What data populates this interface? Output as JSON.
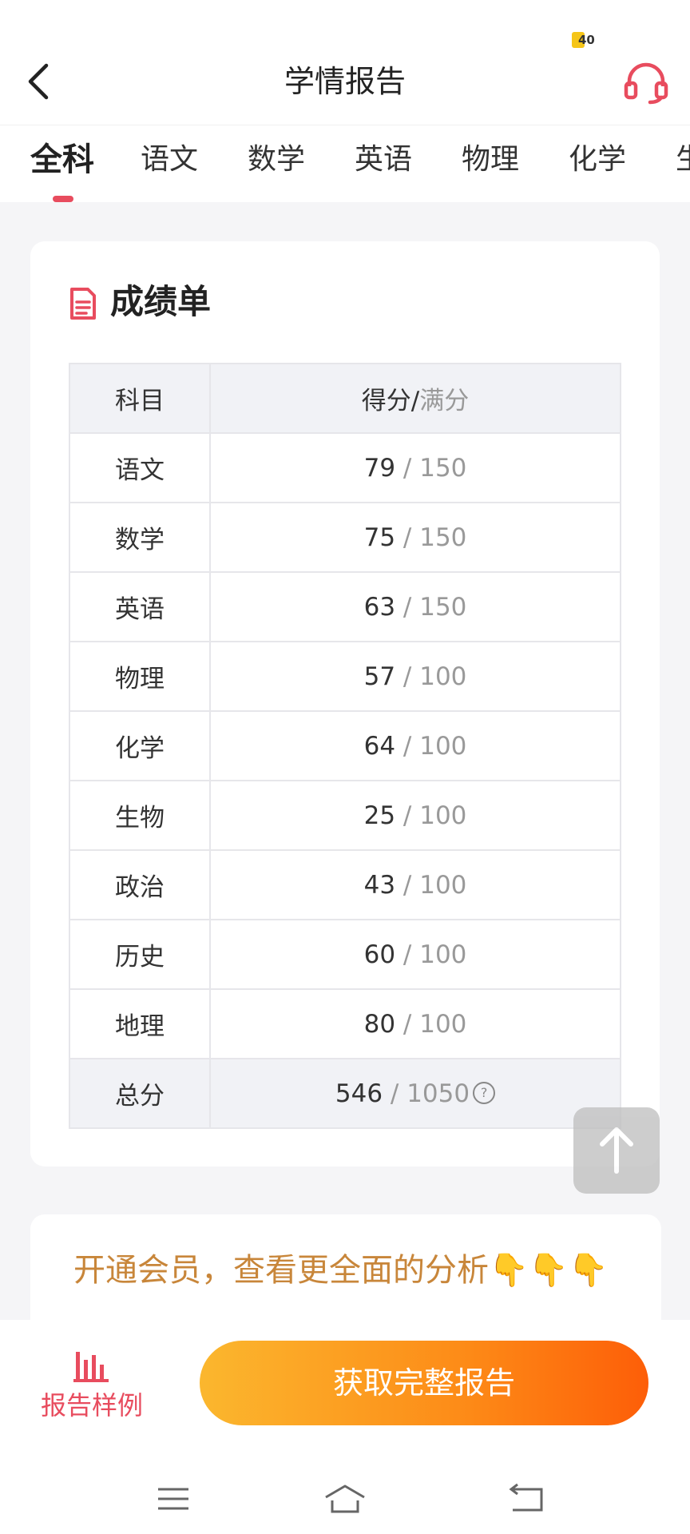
{
  "header": {
    "title": "学情报告",
    "badge": "40"
  },
  "tabs": [
    "全科",
    "语文",
    "数学",
    "英语",
    "物理",
    "化学",
    "生"
  ],
  "card": {
    "title": "成绩单",
    "columns": {
      "subject": "科目",
      "score": "得分/",
      "max": "满分"
    },
    "rows": [
      {
        "subject": "语文",
        "score": "79",
        "max": "150"
      },
      {
        "subject": "数学",
        "score": "75",
        "max": "150"
      },
      {
        "subject": "英语",
        "score": "63",
        "max": "150"
      },
      {
        "subject": "物理",
        "score": "57",
        "max": "100"
      },
      {
        "subject": "化学",
        "score": "64",
        "max": "100"
      },
      {
        "subject": "生物",
        "score": "25",
        "max": "100"
      },
      {
        "subject": "政治",
        "score": "43",
        "max": "100"
      },
      {
        "subject": "历史",
        "score": "60",
        "max": "100"
      },
      {
        "subject": "地理",
        "score": "80",
        "max": "100"
      }
    ],
    "total": {
      "label": "总分",
      "score": "546",
      "max": "1050",
      "help": "?"
    }
  },
  "promo": {
    "text": "开通会员，查看更全面的分析👇👇👇"
  },
  "bottom": {
    "sample_label": "报告样例",
    "cta_label": "获取完整报告"
  },
  "colors": {
    "accent": "#e84c5e",
    "cta_start": "#fbb72e",
    "cta_end": "#fd5e08",
    "promo_text": "#c8863a"
  },
  "icons": {
    "back": "chevron-left-icon",
    "service": "headset-icon",
    "doc": "document-icon",
    "top": "arrow-up-icon",
    "sample": "bar-chart-icon"
  }
}
